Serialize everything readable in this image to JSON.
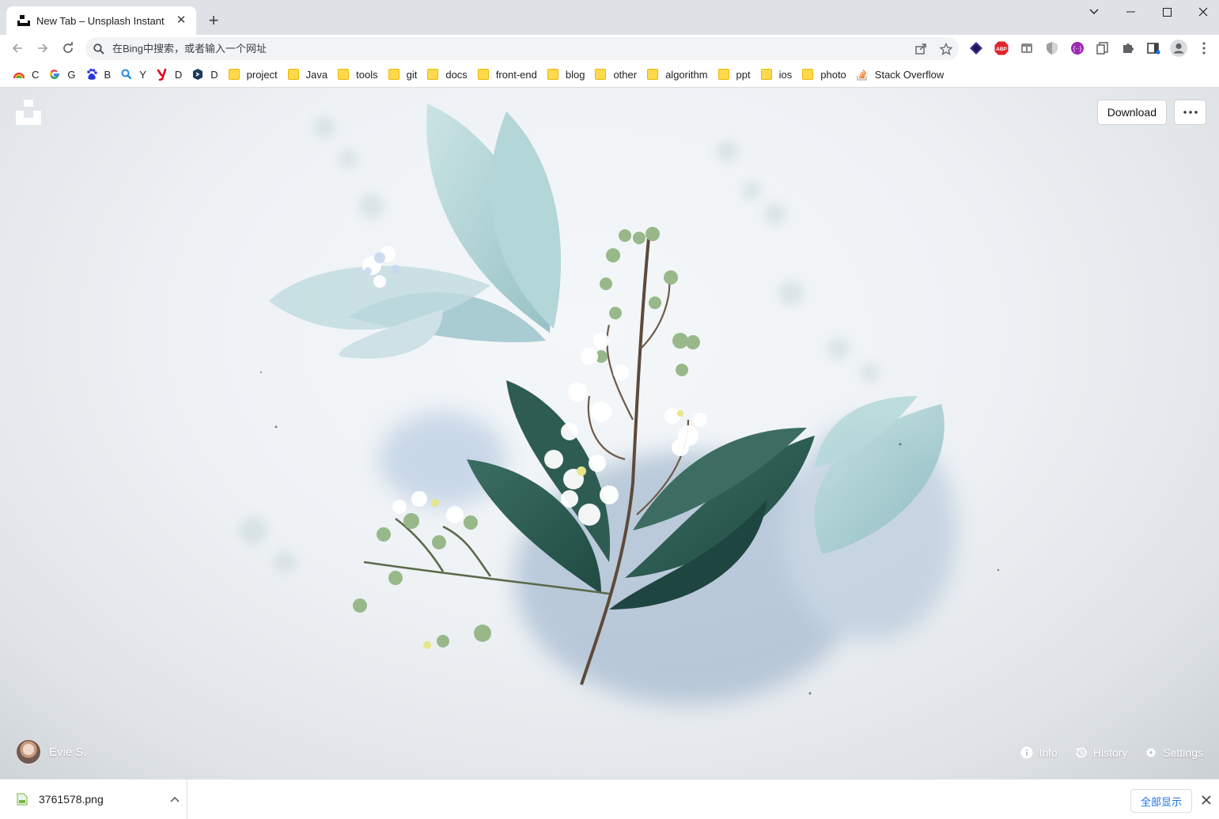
{
  "tab": {
    "title": "New Tab – Unsplash Instant",
    "close_icon": "close-icon"
  },
  "window_controls": {
    "dropdown_icon": "chevron-down-icon",
    "minimize_icon": "minimize-icon",
    "maximize_icon": "maximize-icon",
    "close_icon": "close-icon"
  },
  "toolbar": {
    "back_icon": "back-arrow-icon",
    "forward_icon": "forward-arrow-icon",
    "reload_icon": "reload-icon"
  },
  "omnibox": {
    "placeholder": "在Bing中搜索，或者输入一个网址",
    "value": ""
  },
  "extensions": [
    "share-icon",
    "bookmark-star-icon",
    "layers-extension-icon",
    "adblock-plus-icon",
    "extension-gray-icon",
    "shield-extension-icon",
    "purple-extension-icon",
    "copy-extension-icon",
    "puzzle-icon",
    "reading-list-icon",
    "profile-avatar-icon",
    "kebab-menu-icon"
  ],
  "bookmarks": [
    {
      "label": "C",
      "type": "site",
      "icon": "chrome-rainbow-icon"
    },
    {
      "label": "G",
      "type": "site",
      "icon": "google-icon"
    },
    {
      "label": "B",
      "type": "site",
      "icon": "baidu-paw-icon"
    },
    {
      "label": "Y",
      "type": "site",
      "icon": "magnifier-icon"
    },
    {
      "label": "D",
      "type": "site",
      "icon": "youdao-icon"
    },
    {
      "label": "D",
      "type": "site",
      "icon": "dev-shield-icon"
    },
    {
      "label": "project",
      "type": "folder"
    },
    {
      "label": "Java",
      "type": "folder"
    },
    {
      "label": "tools",
      "type": "folder"
    },
    {
      "label": "git",
      "type": "folder"
    },
    {
      "label": "docs",
      "type": "folder"
    },
    {
      "label": "front-end",
      "type": "folder"
    },
    {
      "label": "blog",
      "type": "folder"
    },
    {
      "label": "other",
      "type": "folder"
    },
    {
      "label": "algorithm",
      "type": "folder"
    },
    {
      "label": "ppt",
      "type": "folder"
    },
    {
      "label": "ios",
      "type": "folder"
    },
    {
      "label": "photo",
      "type": "folder"
    },
    {
      "label": "Stack Overflow",
      "type": "site",
      "icon": "stackoverflow-icon"
    }
  ],
  "page": {
    "download_label": "Download",
    "more_icon": "more-dots-icon",
    "author_name": "Evie S.",
    "actions": [
      {
        "label": "Info",
        "icon": "info-icon"
      },
      {
        "label": "History",
        "icon": "history-icon"
      },
      {
        "label": "Settings",
        "icon": "gear-icon"
      }
    ]
  },
  "download_shelf": {
    "filename": "3761578.png",
    "show_all_label": "全部显示"
  },
  "colors": {
    "tabstrip": "#dee1e6",
    "accent_blue": "#1a73e8",
    "leaf_dark": "#2f5e55",
    "leaf_light": "#9ec9c9"
  }
}
